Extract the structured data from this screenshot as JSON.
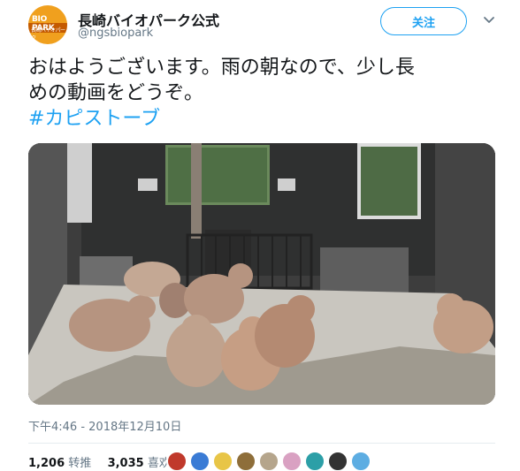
{
  "account": {
    "name": "長崎バイオパーク公式",
    "handle": "@ngsbiopark",
    "avatar_logo_line1": "BIO PARK",
    "avatar_logo_line2": "長崎バイオパーク"
  },
  "follow_label": "关注",
  "tweet": {
    "text_line1": "おはようございます。雨の朝なので、少し長",
    "text_line2": "めの動画をどうぞ。",
    "hashtag": "#カピストーブ"
  },
  "timestamp": "下午4:46 - 2018年12月10日",
  "stats": {
    "retweets_count": "1,206",
    "retweets_label": "转推",
    "likes_count": "3,035",
    "likes_label": "喜欢"
  },
  "colors": {
    "accent": "#1da1f2",
    "avatar": "#f0a01e",
    "text": "#14171a",
    "muted": "#657786"
  },
  "liker_avatar_colors": [
    "#c0392b",
    "#3a7bd5",
    "#e8c547",
    "#8e6e3a",
    "#b5a58c",
    "#d9a1c2",
    "#2c9fa7",
    "#333333",
    "#5dade2"
  ]
}
